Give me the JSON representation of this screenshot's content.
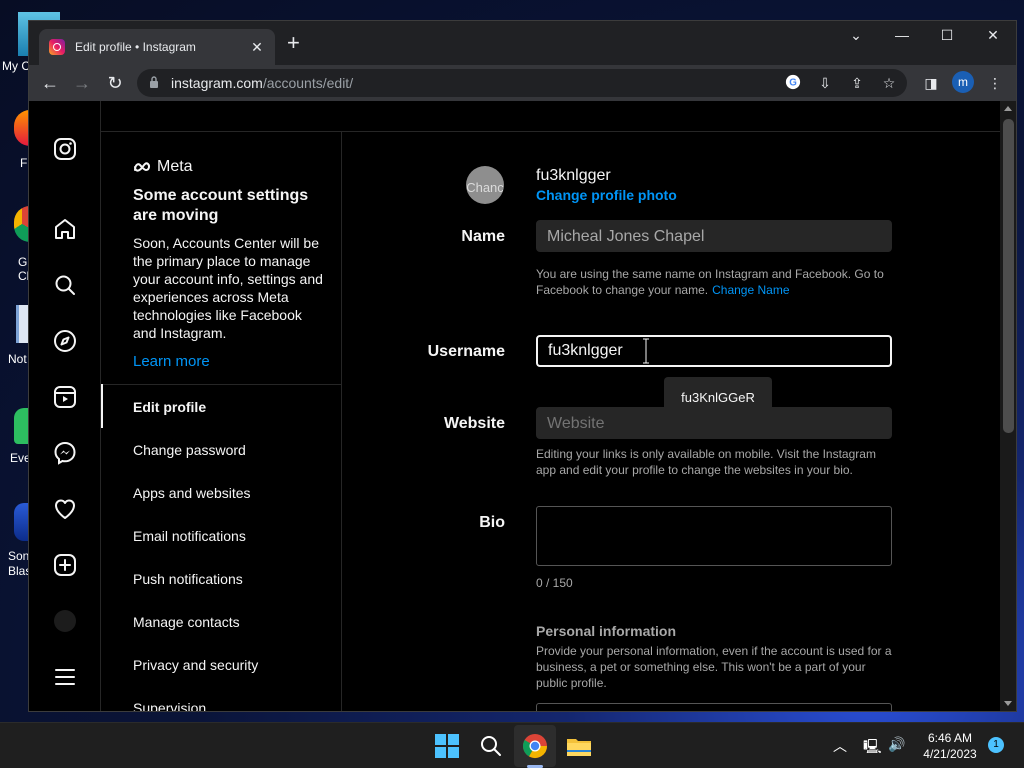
{
  "desktop": {
    "icons": [
      {
        "name": "my-computer",
        "label": "My C"
      },
      {
        "name": "firefox",
        "label": "F"
      },
      {
        "name": "google-chrome",
        "label": "G\nCh"
      },
      {
        "name": "notepad",
        "label": "Not"
      },
      {
        "name": "evernote",
        "label": "Eve"
      },
      {
        "name": "sonic-blast",
        "label": "Son\nBlas"
      }
    ]
  },
  "browser": {
    "tab_title": "Edit profile • Instagram",
    "url_host": "instagram.com",
    "url_path": "/accounts/edit/",
    "profile_initial": "m"
  },
  "sidebar": {
    "meta_logo": "Meta",
    "notice_title": "Some account settings are moving",
    "notice_text": "Soon, Accounts Center will be the primary place to manage your account info, settings and experiences across Meta technologies like Facebook and Instagram.",
    "learn_more": "Learn more",
    "menu": [
      "Edit profile",
      "Change password",
      "Apps and websites",
      "Email notifications",
      "Push notifications",
      "Manage contacts",
      "Privacy and security",
      "Supervision"
    ]
  },
  "form": {
    "avatar_alt": "Chanc",
    "username_display": "fu3knlgger",
    "change_photo": "Change profile photo",
    "name_label": "Name",
    "name_value": "Micheal Jones Chapel",
    "name_hint": "You are using the same name on Instagram and Facebook. Go to Facebook to change your name.",
    "change_name_link": "Change Name",
    "username_label": "Username",
    "username_value": "fu3knlgger",
    "autocomplete_suggestion": "fu3KnlGGeR",
    "website_label": "Website",
    "website_placeholder": "Website",
    "website_hint": "Editing your links is only available on mobile. Visit the Instagram app and edit your profile to change the websites in your bio.",
    "bio_label": "Bio",
    "bio_counter": "0 / 150",
    "personal_info_title": "Personal information",
    "personal_info_text": "Provide your personal information, even if the account is used for a business, a pet or something else. This won't be a part of your public profile."
  },
  "taskbar": {
    "time": "6:46 AM",
    "date": "4/21/2023",
    "notification_count": "1"
  },
  "colors": {
    "link_blue": "#0095f6",
    "input_bg": "#262626"
  }
}
